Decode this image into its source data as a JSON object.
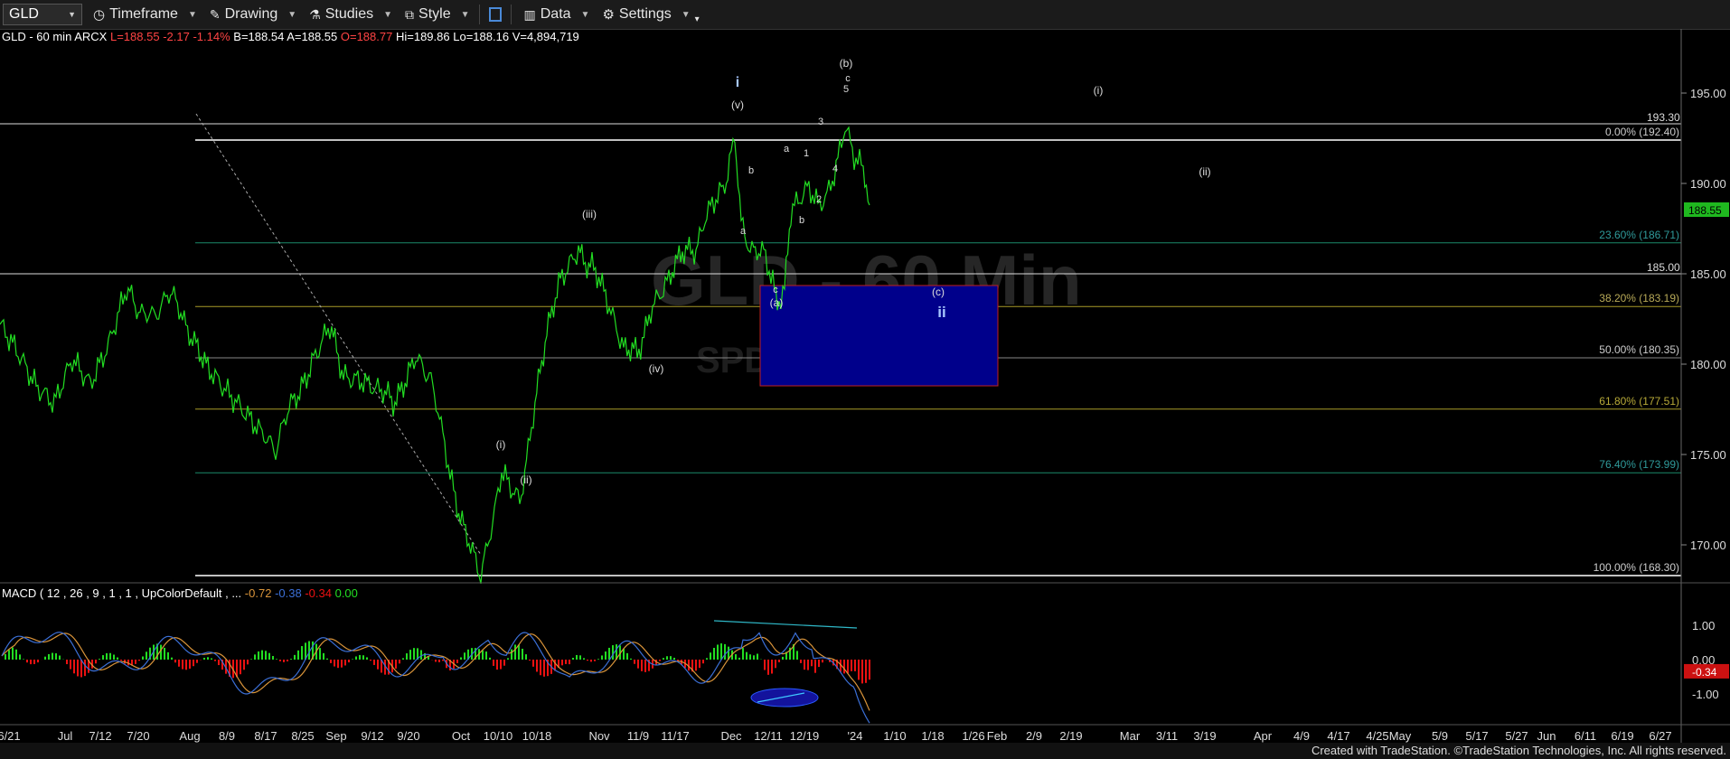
{
  "toolbar": {
    "symbol": "GLD",
    "timeframe": "Timeframe",
    "drawing": "Drawing",
    "studies": "Studies",
    "style": "Style",
    "data": "Data",
    "settings": "Settings"
  },
  "info": {
    "name": "GLD - 60 min",
    "exchange": "ARCX",
    "last": "L=188.55",
    "change": "-2.17",
    "change_pct": "-1.14%",
    "bid": "B=188.54",
    "ask": "A=188.55",
    "open": "O=188.77",
    "high": "Hi=189.86",
    "low": "Lo=188.16",
    "volume": "V=4,894,719"
  },
  "macd": {
    "label": "MACD ( 12 , 26 , 9 , 1 , 1 , UpColorDefault , ...",
    "v1": "-0.72",
    "v2": "-0.38",
    "v3": "-0.34",
    "v4": "0.00"
  },
  "price_axis": [
    "195.00",
    "190.00",
    "185.00",
    "180.00",
    "175.00",
    "170.00"
  ],
  "price_tags": {
    "p1933": "193.30",
    "p1850": "185.00",
    "last": "188.55"
  },
  "macd_axis": [
    "1.00",
    "0.00",
    "-1.00"
  ],
  "macd_tag": "-0.34",
  "fib_labels": [
    "0.00% (192.40)",
    "23.60% (186.71)",
    "38.20% (183.19)",
    "50.00% (180.35)",
    "61.80% (177.51)",
    "76.40% (173.99)",
    "100.00% (168.30)"
  ],
  "x_labels": [
    "6/21",
    "Jul",
    "7/12",
    "7/20",
    "Aug",
    "8/9",
    "8/17",
    "8/25",
    "Sep",
    "9/12",
    "9/20",
    "Oct",
    "10/10",
    "10/18",
    "Nov",
    "11/9",
    "11/17",
    "Dec",
    "12/11",
    "12/19",
    "'24",
    "1/10",
    "1/18",
    "1/26",
    "Feb",
    "2/9",
    "2/19",
    "Mar",
    "3/11",
    "3/19",
    "Apr",
    "4/9",
    "4/17",
    "4/25",
    "May",
    "5/9",
    "5/17",
    "5/27",
    "Jun",
    "6/11",
    "6/19",
    "6/27"
  ],
  "wave_labels": {
    "i": "i",
    "v_paren": "(v)",
    "b_paren": "(b)",
    "c_small": "c",
    "five": "5",
    "i_paren_right": "(i)",
    "ii_paren_right": "(ii)",
    "three": "3",
    "one": "1",
    "four": "4",
    "two": "2",
    "a1": "a",
    "b1": "b",
    "a2": "a",
    "b2": "b",
    "c2": "c",
    "a_paren": "(a)",
    "c_paren": "(c)",
    "ii": "ii",
    "iii_paren": "(iii)",
    "iv_paren": "(iv)",
    "i_paren_left": "(i)",
    "ii_paren_left": "(ii)"
  },
  "watermark": {
    "line1": "GLD - 60 Min",
    "line2": "SPDR"
  },
  "footer": "Created with TradeStation. ©TradeStation Technologies, Inc. All rights reserved.",
  "colors": {
    "price": "#22dd22",
    "box": "#00008b",
    "fib0": "#ffffff",
    "fib236": "#1a8a6a",
    "fib382": "#a89a28",
    "fib50": "#888888",
    "fib618": "#a89a28",
    "fib764": "#1a8a6a",
    "macd_up": "#22dd22",
    "macd_down": "#ee1111",
    "macd_line": "#3b6fd6",
    "signal_line": "#d9943a"
  }
}
